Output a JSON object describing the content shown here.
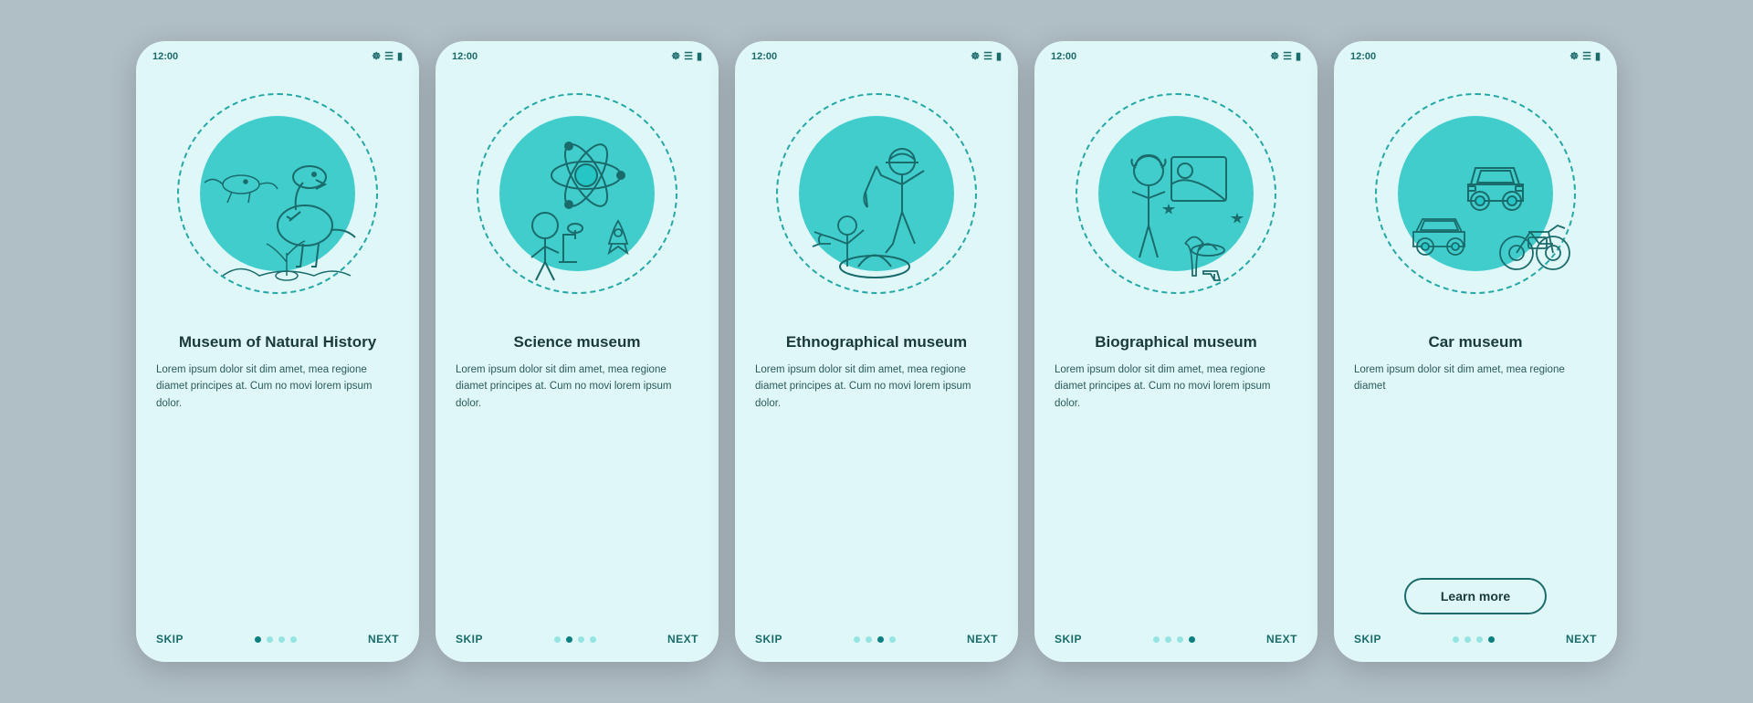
{
  "phones": [
    {
      "id": "phone-1",
      "time": "12:00",
      "title": "Museum of Natural History",
      "description": "Lorem ipsum dolor sit dim amet, mea regione diamet principes at. Cum no movi lorem ipsum dolor.",
      "active_dot": 0,
      "show_learn_more": false,
      "illustration": "natural-history"
    },
    {
      "id": "phone-2",
      "time": "12:00",
      "title": "Science museum",
      "description": "Lorem ipsum dolor sit dim amet, mea regione diamet principes at. Cum no movi lorem ipsum dolor.",
      "active_dot": 1,
      "show_learn_more": false,
      "illustration": "science"
    },
    {
      "id": "phone-3",
      "time": "12:00",
      "title": "Ethnographical museum",
      "description": "Lorem ipsum dolor sit dim amet, mea regione diamet principes at. Cum no movi lorem ipsum dolor.",
      "active_dot": 2,
      "show_learn_more": false,
      "illustration": "ethnographical"
    },
    {
      "id": "phone-4",
      "time": "12:00",
      "title": "Biographical museum",
      "description": "Lorem ipsum dolor sit dim amet, mea regione diamet principes at. Cum no movi lorem ipsum dolor.",
      "active_dot": 3,
      "show_learn_more": false,
      "illustration": "biographical"
    },
    {
      "id": "phone-5",
      "time": "12:00",
      "title": "Car museum",
      "description": "Lorem ipsum dolor sit dim amet, mea regione diamet",
      "active_dot": 3,
      "show_learn_more": true,
      "learn_more_label": "Learn more",
      "illustration": "car"
    }
  ],
  "nav": {
    "skip": "SKIP",
    "next": "NEXT"
  },
  "colors": {
    "teal": "#26c6c6",
    "dark_teal": "#0a8080",
    "accent": "#1a6b6b",
    "text_dark": "#1a3a3a"
  }
}
